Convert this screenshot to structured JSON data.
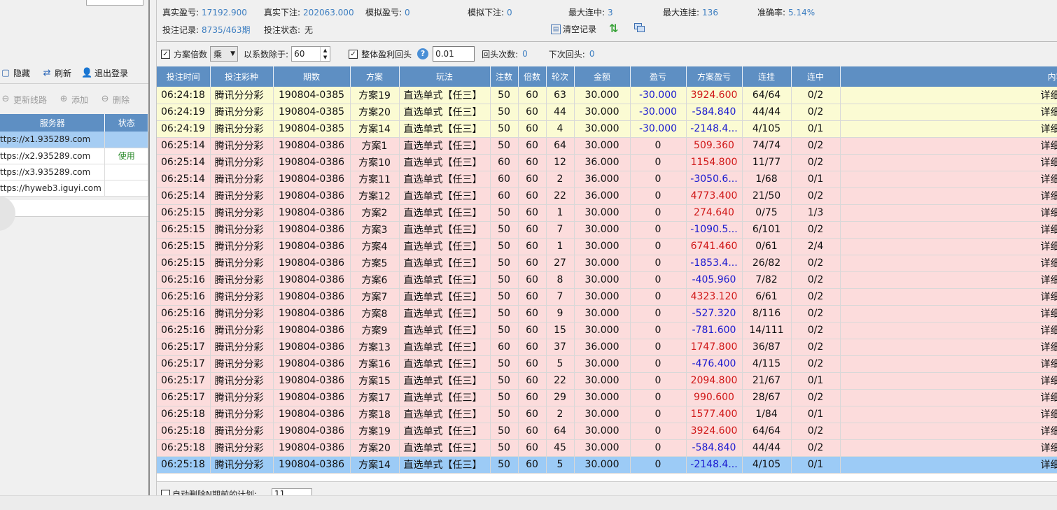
{
  "left": {
    "toolbar1": [
      {
        "icon": "hide-icon",
        "label": "隐藏"
      },
      {
        "icon": "refresh-icon",
        "label": "刷新"
      },
      {
        "icon": "user-icon",
        "label": "退出登录"
      }
    ],
    "toolbar2": [
      {
        "icon": "update-icon",
        "label": "更新线路"
      },
      {
        "icon": "add-icon",
        "label": "添加"
      },
      {
        "icon": "delete-icon",
        "label": "删除"
      }
    ],
    "server_headers": [
      "服务器",
      "状态"
    ],
    "servers": [
      {
        "url": "ttps://x1.935289.com",
        "status": ""
      },
      {
        "url": "ttps://x2.935289.com",
        "status": "使用"
      },
      {
        "url": "ttps://x3.935289.com",
        "status": ""
      },
      {
        "url": "ttps://hyweb3.iguyi.com",
        "status": ""
      }
    ]
  },
  "stats": {
    "real_profit": {
      "label": "真实盈亏:",
      "value": "17192.900"
    },
    "real_bet": {
      "label": "真实下注:",
      "value": "202063.000"
    },
    "sim_profit": {
      "label": "模拟盈亏:",
      "value": "0"
    },
    "sim_bet": {
      "label": "模拟下注:",
      "value": "0"
    },
    "max_win_streak": {
      "label": "最大连中:",
      "value": "3"
    },
    "max_lose_streak": {
      "label": "最大连挂:",
      "value": "136"
    },
    "accuracy": {
      "label": "准确率:",
      "value": "5.14%"
    },
    "bet_record": {
      "label": "投注记录:",
      "value": "8735/463期"
    },
    "bet_status": {
      "label": "投注状态:",
      "value": "无"
    },
    "clear_label": "清空记录"
  },
  "options": {
    "multiplier_label": "方案倍数",
    "op_select": "乘",
    "divide_label": "以系数除于:",
    "divide_value": "60",
    "overall_label": "整体盈利回头",
    "overall_value": "0.01",
    "return_count_label": "回头次数:",
    "return_count_value": "0",
    "next_return_label": "下次回头:",
    "next_return_value": "0"
  },
  "grid": {
    "headers": [
      "投注时间",
      "投注彩种",
      "期数",
      "方案",
      "玩法",
      "注数",
      "倍数",
      "轮次",
      "金额",
      "盈亏",
      "方案盈亏",
      "连挂",
      "连中",
      "内容"
    ],
    "rows": [
      {
        "s": "y",
        "c": [
          "06:24:18",
          "腾讯分分彩",
          "190804-0385",
          "方案19",
          "直选单式【任三】",
          "50",
          "60",
          "63",
          "30.000",
          "-30.000",
          "3924.600",
          "64/64",
          "0/2",
          "详细请点击"
        ]
      },
      {
        "s": "y",
        "c": [
          "06:24:19",
          "腾讯分分彩",
          "190804-0385",
          "方案20",
          "直选单式【任三】",
          "50",
          "60",
          "44",
          "30.000",
          "-30.000",
          "-584.840",
          "44/44",
          "0/2",
          "详细请点击"
        ]
      },
      {
        "s": "y",
        "c": [
          "06:24:19",
          "腾讯分分彩",
          "190804-0385",
          "方案14",
          "直选单式【任三】",
          "50",
          "60",
          "4",
          "30.000",
          "-30.000",
          "-2148.4...",
          "4/105",
          "0/1",
          "详细请点击"
        ]
      },
      {
        "s": "p",
        "c": [
          "06:25:14",
          "腾讯分分彩",
          "190804-0386",
          "方案1",
          "直选单式【任三】",
          "50",
          "60",
          "64",
          "30.000",
          "0",
          "509.360",
          "74/74",
          "0/2",
          "详细请点击"
        ]
      },
      {
        "s": "p",
        "c": [
          "06:25:14",
          "腾讯分分彩",
          "190804-0386",
          "方案10",
          "直选单式【任三】",
          "60",
          "60",
          "12",
          "36.000",
          "0",
          "1154.800",
          "11/77",
          "0/2",
          "详细请点击"
        ]
      },
      {
        "s": "p",
        "c": [
          "06:25:14",
          "腾讯分分彩",
          "190804-0386",
          "方案11",
          "直选单式【任三】",
          "60",
          "60",
          "2",
          "36.000",
          "0",
          "-3050.6...",
          "1/68",
          "0/1",
          "详细请点击"
        ]
      },
      {
        "s": "p",
        "c": [
          "06:25:14",
          "腾讯分分彩",
          "190804-0386",
          "方案12",
          "直选单式【任三】",
          "60",
          "60",
          "22",
          "36.000",
          "0",
          "4773.400",
          "21/50",
          "0/2",
          "详细请点击"
        ]
      },
      {
        "s": "p",
        "c": [
          "06:25:15",
          "腾讯分分彩",
          "190804-0386",
          "方案2",
          "直选单式【任三】",
          "50",
          "60",
          "1",
          "30.000",
          "0",
          "274.640",
          "0/75",
          "1/3",
          "详细请点击"
        ]
      },
      {
        "s": "p",
        "c": [
          "06:25:15",
          "腾讯分分彩",
          "190804-0386",
          "方案3",
          "直选单式【任三】",
          "50",
          "60",
          "7",
          "30.000",
          "0",
          "-1090.5...",
          "6/101",
          "0/2",
          "详细请点击"
        ]
      },
      {
        "s": "p",
        "c": [
          "06:25:15",
          "腾讯分分彩",
          "190804-0386",
          "方案4",
          "直选单式【任三】",
          "50",
          "60",
          "1",
          "30.000",
          "0",
          "6741.460",
          "0/61",
          "2/4",
          "详细请点击"
        ]
      },
      {
        "s": "p",
        "c": [
          "06:25:15",
          "腾讯分分彩",
          "190804-0386",
          "方案5",
          "直选单式【任三】",
          "50",
          "60",
          "27",
          "30.000",
          "0",
          "-1853.4...",
          "26/82",
          "0/2",
          "详细请点击"
        ]
      },
      {
        "s": "p",
        "c": [
          "06:25:16",
          "腾讯分分彩",
          "190804-0386",
          "方案6",
          "直选单式【任三】",
          "50",
          "60",
          "8",
          "30.000",
          "0",
          "-405.960",
          "7/82",
          "0/2",
          "详细请点击"
        ]
      },
      {
        "s": "p",
        "c": [
          "06:25:16",
          "腾讯分分彩",
          "190804-0386",
          "方案7",
          "直选单式【任三】",
          "50",
          "60",
          "7",
          "30.000",
          "0",
          "4323.120",
          "6/61",
          "0/2",
          "详细请点击"
        ]
      },
      {
        "s": "p",
        "c": [
          "06:25:16",
          "腾讯分分彩",
          "190804-0386",
          "方案8",
          "直选单式【任三】",
          "50",
          "60",
          "9",
          "30.000",
          "0",
          "-527.320",
          "8/116",
          "0/2",
          "详细请点击"
        ]
      },
      {
        "s": "p",
        "c": [
          "06:25:16",
          "腾讯分分彩",
          "190804-0386",
          "方案9",
          "直选单式【任三】",
          "50",
          "60",
          "15",
          "30.000",
          "0",
          "-781.600",
          "14/111",
          "0/2",
          "详细请点击"
        ]
      },
      {
        "s": "p",
        "c": [
          "06:25:17",
          "腾讯分分彩",
          "190804-0386",
          "方案13",
          "直选单式【任三】",
          "60",
          "60",
          "37",
          "36.000",
          "0",
          "1747.800",
          "36/87",
          "0/2",
          "详细请点击"
        ]
      },
      {
        "s": "p",
        "c": [
          "06:25:17",
          "腾讯分分彩",
          "190804-0386",
          "方案16",
          "直选单式【任三】",
          "50",
          "60",
          "5",
          "30.000",
          "0",
          "-476.400",
          "4/115",
          "0/2",
          "详细请点击"
        ]
      },
      {
        "s": "p",
        "c": [
          "06:25:17",
          "腾讯分分彩",
          "190804-0386",
          "方案15",
          "直选单式【任三】",
          "50",
          "60",
          "22",
          "30.000",
          "0",
          "2094.800",
          "21/67",
          "0/1",
          "详细请点击"
        ]
      },
      {
        "s": "p",
        "c": [
          "06:25:17",
          "腾讯分分彩",
          "190804-0386",
          "方案17",
          "直选单式【任三】",
          "50",
          "60",
          "29",
          "30.000",
          "0",
          "990.600",
          "28/67",
          "0/2",
          "详细请点击"
        ]
      },
      {
        "s": "p",
        "c": [
          "06:25:18",
          "腾讯分分彩",
          "190804-0386",
          "方案18",
          "直选单式【任三】",
          "50",
          "60",
          "2",
          "30.000",
          "0",
          "1577.400",
          "1/84",
          "0/1",
          "详细请点击"
        ]
      },
      {
        "s": "p",
        "c": [
          "06:25:18",
          "腾讯分分彩",
          "190804-0386",
          "方案19",
          "直选单式【任三】",
          "50",
          "60",
          "64",
          "30.000",
          "0",
          "3924.600",
          "64/64",
          "0/2",
          "详细请点击"
        ]
      },
      {
        "s": "p",
        "c": [
          "06:25:18",
          "腾讯分分彩",
          "190804-0386",
          "方案20",
          "直选单式【任三】",
          "50",
          "60",
          "45",
          "30.000",
          "0",
          "-584.840",
          "44/44",
          "0/2",
          "详细请点击"
        ]
      },
      {
        "s": "s",
        "c": [
          "06:25:18",
          "腾讯分分彩",
          "190804-0386",
          "方案14",
          "直选单式【任三】",
          "50",
          "60",
          "5",
          "30.000",
          "0",
          "-2148.4...",
          "4/105",
          "0/1",
          "详细请点击"
        ]
      }
    ]
  },
  "bottom": {
    "auto_delete_label": "自动删除N期前的计划:",
    "auto_delete_value": "11"
  },
  "colors": {
    "header_bg": "#5e8fc3",
    "loss": "#1a1ad0",
    "profit": "#d01818",
    "yellow_row": "#fbfbd3",
    "pink_row": "#fcdcdc",
    "selected_row": "#9ccbf6"
  }
}
